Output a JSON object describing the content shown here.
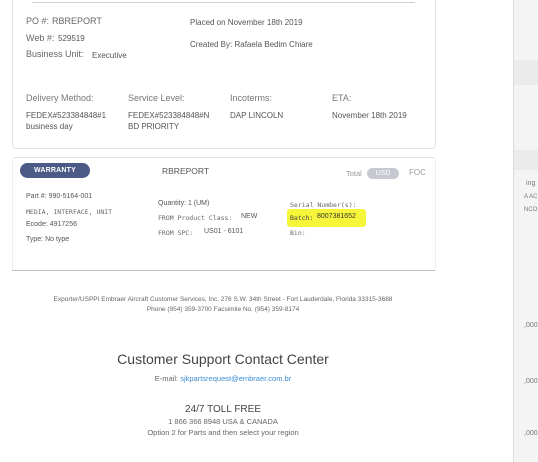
{
  "order": {
    "po_label": "PO #:",
    "po_value": "RBREPORT",
    "web_label": "Web #:",
    "web_value": "529519",
    "bu_label": "Business Unit:",
    "bu_value": "Executive",
    "placed": "Placed on November 18th 2019",
    "created": "Created By: Rafaela Bedim Chiare"
  },
  "shipping": {
    "delivery_label": "Delivery Method:",
    "delivery_line1": "FEDEX#523384848#1",
    "delivery_line2": "business day",
    "service_label": "Service Level:",
    "service_line1": "FEDEX#523384848#N",
    "service_line2": "BD PRIORITY",
    "incoterms_label": "Incoterms:",
    "incoterms_value": "DAP LINCOLN",
    "eta_label": "ETA:",
    "eta_value": "November 18th 2019"
  },
  "item": {
    "badge": "WARRANTY",
    "report": "RBREPORT",
    "total_label": "Total",
    "currency": "USD",
    "foc": "FOC",
    "part": "Part #: 990-5164-001",
    "description": "MEDIA, INTERFACE, UNIT",
    "ecode": "Ecode: 4917256",
    "type": "Type: No type",
    "quantity": "Quantity: 1 (UM)",
    "product_class_label": "FROM Product Class:",
    "product_class_value": "NEW",
    "spc_label": "FROM SPC:",
    "spc_value": "US01 - 6101",
    "serial_label": "Serial Number(s):",
    "batch_label": "Batch:",
    "batch_value": "8007381652",
    "bin_label": "Bin:"
  },
  "footer": {
    "exporter": "Exporter/USPPI Embraer Aircraft Customer Services, Inc. 276 S.W. 34th Street - Fort Lauderdale, Florida 33315-3688",
    "phone": "Phone (954) 359-3700 Facsimile No. (954) 359-8174",
    "contact_title": "Customer Support Contact Center",
    "email_label": "E-mail:",
    "email": "sjkpartsrequest@embraer.com.br",
    "toll_title": "24/7 TOLL FREE",
    "toll_number": "1 866 366 8948 USA & CANADA",
    "toll_note": "Option 2 for Parts and then select your region"
  },
  "side_panel": {
    "frag1": "ing",
    "frag2": "A AC",
    "frag3": "NCO",
    "frag4": ",000",
    "frag5": ",000",
    "frag6": ",000"
  }
}
